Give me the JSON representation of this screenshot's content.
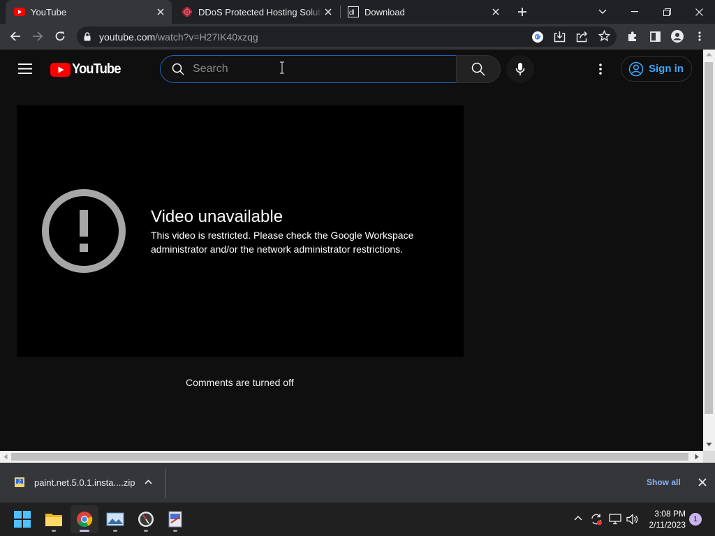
{
  "browser": {
    "tabs": [
      {
        "title": "YouTube",
        "icon": "youtube-favicon",
        "active": true
      },
      {
        "title": "DDoS Protected Hosting Solution",
        "icon": "ddos-favicon",
        "active": false
      },
      {
        "title": "Download",
        "icon": "download-site-favicon",
        "active": false
      }
    ],
    "url_host": "youtube.com",
    "url_path": "/watch?v=H27IK40xzqg"
  },
  "youtube": {
    "logo_text": "YouTube",
    "search_placeholder": "Search",
    "sign_in": "Sign in",
    "error_title": "Video unavailable",
    "error_message": "This video is restricted. Please check the Google Workspace administrator and/or the network administrator restrictions.",
    "comments_status": "Comments are turned off"
  },
  "download_shelf": {
    "file_name": "paint.net.5.0.1.insta....zip",
    "show_all": "Show all"
  },
  "taskbar": {
    "time": "3:08 PM",
    "date": "2/11/2023",
    "notification_count": "1"
  },
  "colors": {
    "youtube_red": "#ff0000",
    "link_blue": "#3ea6ff",
    "search_focus": "#1c62b9",
    "shelf_link": "#8ab4f8"
  }
}
